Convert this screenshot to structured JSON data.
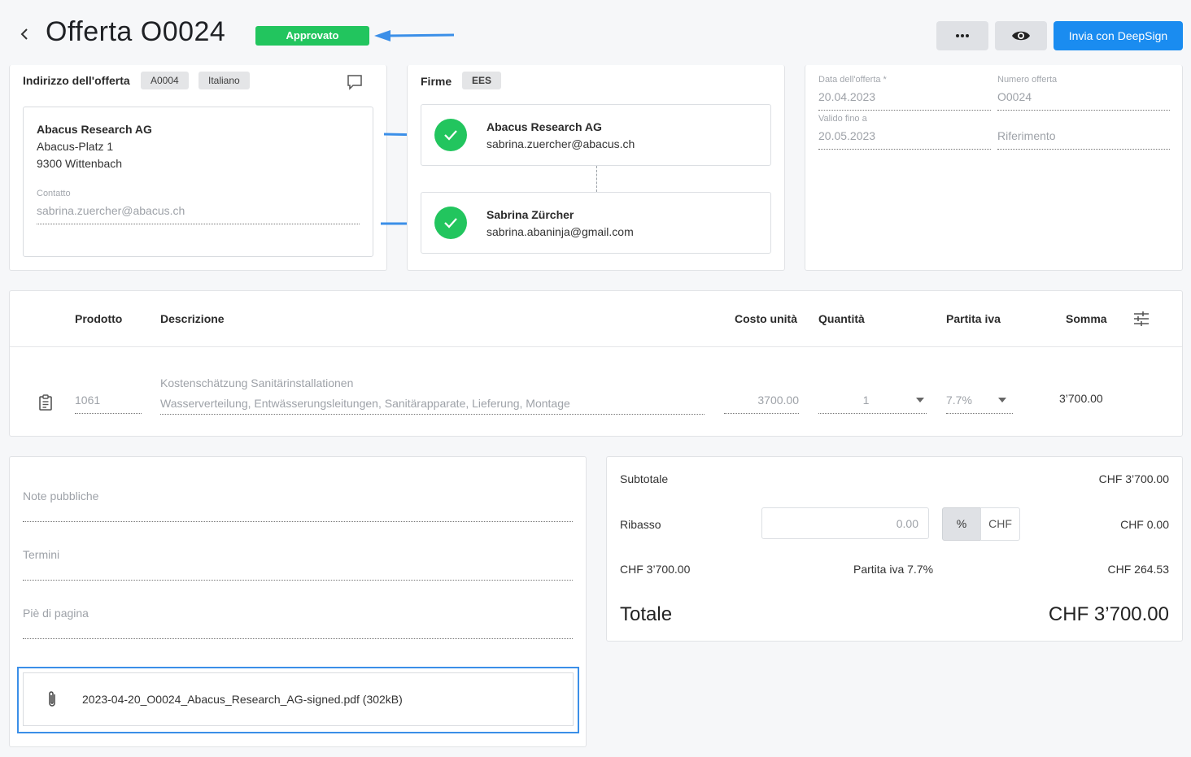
{
  "header": {
    "title": "Offerta O0024",
    "status": "Approvato",
    "send_button": "Invia con DeepSign"
  },
  "address": {
    "heading": "Indirizzo dell'offerta",
    "chip_code": "A0004",
    "chip_lang": "Italiano",
    "company": "Abacus Research AG",
    "street": "Abacus-Platz 1",
    "city": "9300 Wittenbach",
    "contact_label": "Contatto",
    "contact_value": "sabrina.zuercher@abacus.ch"
  },
  "signatures": {
    "heading": "Firme",
    "chip": "EES",
    "items": [
      {
        "name": "Abacus Research AG",
        "email": "sabrina.zuercher@abacus.ch"
      },
      {
        "name": "Sabrina Zürcher",
        "email": "sabrina.abaninja@gmail.com"
      }
    ]
  },
  "meta": {
    "date_label": "Data dell'offerta *",
    "date_value": "20.04.2023",
    "number_label": "Numero offerta",
    "number_value": "O0024",
    "valid_label": "Valido fino a",
    "valid_value": "20.05.2023",
    "reference_placeholder": "Riferimento"
  },
  "table": {
    "headers": {
      "product": "Prodotto",
      "description": "Descrizione",
      "unit_cost": "Costo unità",
      "quantity": "Quantità",
      "vat": "Partita iva",
      "sum": "Somma"
    },
    "rows": [
      {
        "product": "1061",
        "title": "Kostenschätzung Sanitärinstallationen",
        "description": "Wasserverteilung, Entwässerungsleitungen, Sanitärapparate, Lieferung, Montage",
        "unit_cost": "3700.00",
        "quantity": "1",
        "vat": "7.7%",
        "sum": "3’700.00"
      }
    ]
  },
  "notes": {
    "public_notes": "Note pubbliche",
    "terms": "Termini",
    "footer": "Piè di pagina",
    "attachment": "2023-04-20_O0024_Abacus_Research_AG-signed.pdf (302kB)"
  },
  "totals": {
    "subtotal_label": "Subtotale",
    "subtotal_value": "CHF 3’700.00",
    "discount_label": "Ribasso",
    "discount_placeholder": "0.00",
    "discount_percent": "%",
    "discount_chf": "CHF",
    "discount_value": "CHF 0.00",
    "vat_base": "CHF 3’700.00",
    "vat_label": "Partita iva 7.7%",
    "vat_value": "CHF 264.53",
    "total_label": "Totale",
    "total_value": "CHF 3’700.00"
  },
  "colors": {
    "accent": "#1a8cf0",
    "success": "#22c55e",
    "annotation": "#3b8fe8"
  }
}
